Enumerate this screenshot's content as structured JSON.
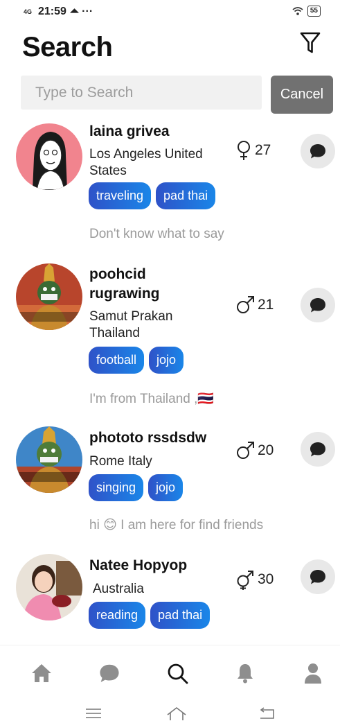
{
  "status_bar": {
    "network": "4G",
    "time": "21:59",
    "notification_icons": "⏶ ···",
    "battery": "55"
  },
  "header": {
    "title": "Search"
  },
  "search": {
    "placeholder": "Type to Search",
    "value": "",
    "cancel_label": "Cancel"
  },
  "users": [
    {
      "name": "laina grivea",
      "location": "Los Angeles United States",
      "gender": "female",
      "age": "27",
      "tags": [
        "traveling",
        "pad thai"
      ],
      "bio": "Don't know what to say"
    },
    {
      "name": "poohcid rugrawing",
      "location": "Samut Prakan Thailand",
      "gender": "male",
      "age": "21",
      "tags": [
        "football",
        "jojo"
      ],
      "bio": "I'm from Thailand ,🇹🇭"
    },
    {
      "name": "phototo rssdsdw",
      "location": "Rome Italy",
      "gender": "male",
      "age": "20",
      "tags": [
        "singing",
        "jojo"
      ],
      "bio": "hi 😊 I am here for find friends"
    },
    {
      "name": "Natee Hopyop",
      "location": "Australia",
      "gender": "non-binary",
      "age": "30",
      "tags": [
        "reading",
        "pad thai"
      ],
      "bio": ""
    }
  ],
  "bottom_nav": [
    "home-icon",
    "chat-icon",
    "search-icon",
    "bell-icon",
    "profile-icon"
  ],
  "colors": {
    "tag_start": "#2f52c8",
    "tag_end": "#1a86e8",
    "cancel_bg": "#717171",
    "icon_gray": "#8e8e8e"
  }
}
